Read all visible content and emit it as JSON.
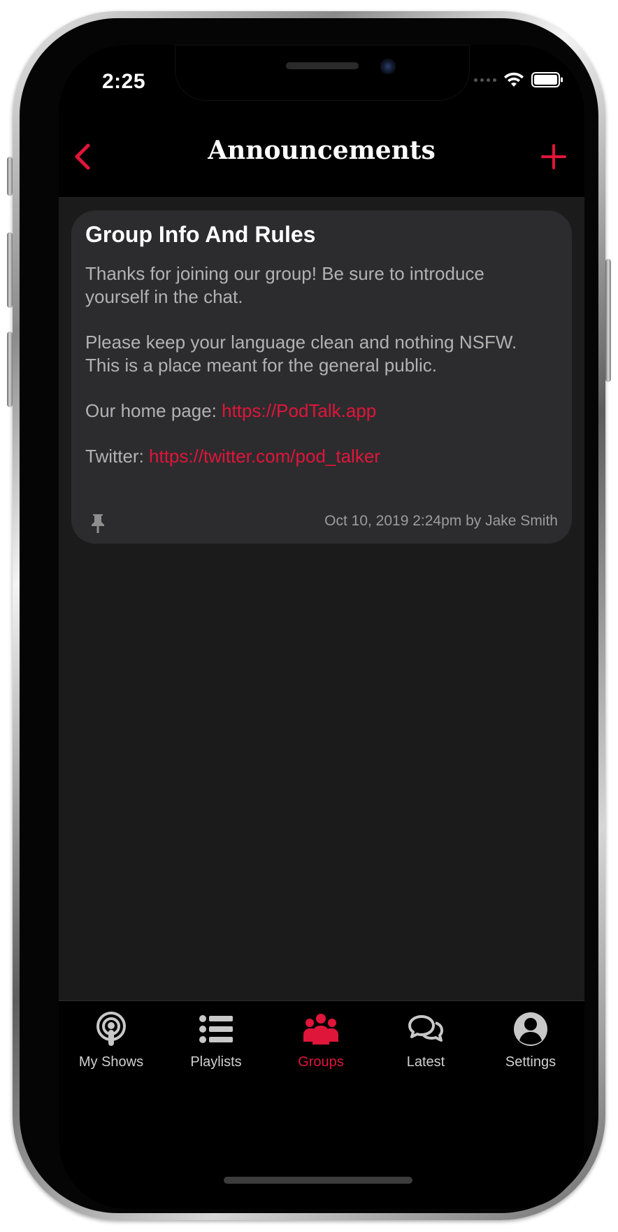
{
  "status_bar": {
    "time": "2:25"
  },
  "nav": {
    "title": "Announcements"
  },
  "announcement": {
    "title": "Group Info And Rules",
    "paragraph1": "Thanks for joining our group! Be sure to introduce yourself in the chat.",
    "paragraph2": "Please keep your language clean and nothing NSFW. This is a place meant for the general public.",
    "home_label": "Our home page: ",
    "home_link": "https://PodTalk.app",
    "twitter_label": "Twitter: ",
    "twitter_link": "https://twitter.com/pod_talker",
    "meta": "Oct 10, 2019 2:24pm by Jake Smith",
    "pinned": true
  },
  "tabs": [
    {
      "label": "My Shows",
      "icon": "podcast-icon",
      "active": false
    },
    {
      "label": "Playlists",
      "icon": "list-icon",
      "active": false
    },
    {
      "label": "Groups",
      "icon": "group-icon",
      "active": true
    },
    {
      "label": "Latest",
      "icon": "chat-bubbles-icon",
      "active": false
    },
    {
      "label": "Settings",
      "icon": "user-circle-icon",
      "active": false
    }
  ],
  "colors": {
    "accent": "#e0153a",
    "background": "#1b1b1b",
    "card": "#2c2c2e",
    "bar": "#000000"
  }
}
